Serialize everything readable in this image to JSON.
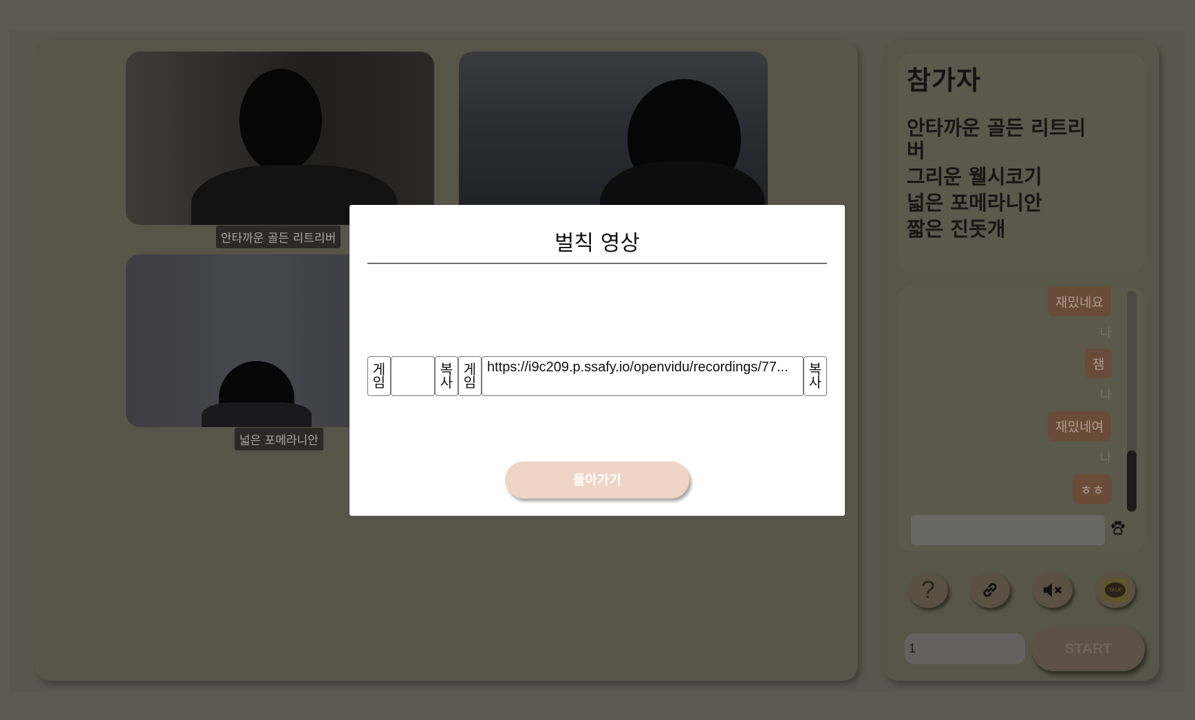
{
  "videos": [
    {
      "name": "안타까운 골든 리트리버"
    },
    {
      "name": ""
    },
    {
      "name": "넓은 포메라니안"
    }
  ],
  "participants": {
    "title": "참가자",
    "list": [
      "안타까운 골든 리트리",
      "버",
      "그리운 웰시코기",
      "넓은 포메라니안",
      "짧은 진돗개"
    ]
  },
  "chat": {
    "messages": [
      {
        "text": "재밌네요"
      },
      {
        "sender": "나",
        "text": "잼"
      },
      {
        "sender": "나",
        "text": "재밌네여"
      },
      {
        "sender": "나",
        "text": "ㅎㅎ"
      }
    ],
    "input_value": ""
  },
  "toolbar": {
    "help_label": "?",
    "talk_label": "TALK"
  },
  "round": {
    "value": "1"
  },
  "start_label": "START",
  "modal": {
    "title": "벌칙 영상",
    "cells": [
      {
        "label": "게\n임"
      },
      {
        "label": ""
      },
      {
        "label": "복\n사"
      },
      {
        "label": "게\n임"
      },
      {
        "label": "https://i9c209.p.ssafy.io/openvidu/recordings/77..."
      },
      {
        "label": "복\n사"
      }
    ],
    "back_label": "돌아가기"
  }
}
